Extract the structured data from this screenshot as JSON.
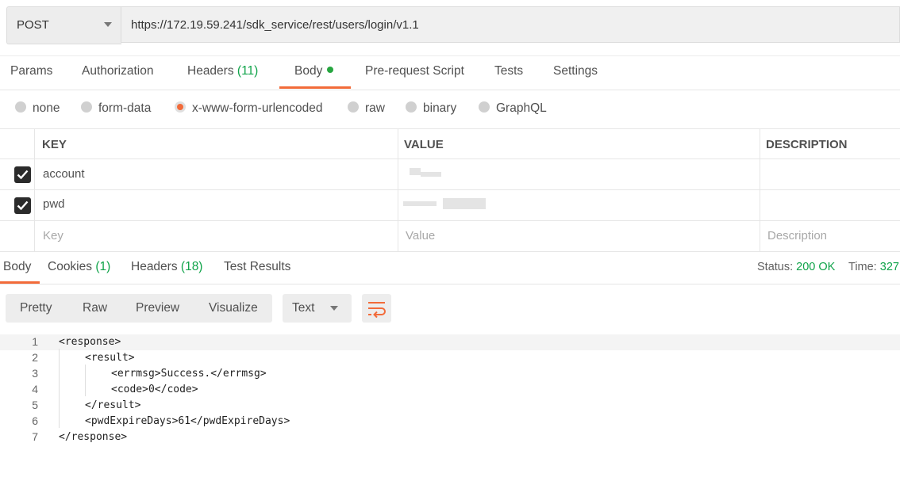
{
  "request": {
    "method": "POST",
    "url": "https://172.19.59.241/sdk_service/rest/users/login/v1.1"
  },
  "request_tabs": [
    {
      "label": "Params",
      "count": ""
    },
    {
      "label": "Authorization",
      "count": ""
    },
    {
      "label": "Headers",
      "count": "(11)"
    },
    {
      "label": "Body",
      "count": ""
    },
    {
      "label": "Pre-request Script",
      "count": ""
    },
    {
      "label": "Tests",
      "count": ""
    },
    {
      "label": "Settings",
      "count": ""
    }
  ],
  "body_types": [
    "none",
    "form-data",
    "x-www-form-urlencoded",
    "raw",
    "binary",
    "GraphQL"
  ],
  "body_type_selected": "x-www-form-urlencoded",
  "table": {
    "headers": [
      "KEY",
      "VALUE",
      "DESCRIPTION"
    ],
    "rows": [
      {
        "key": "account",
        "checked": true
      },
      {
        "key": "pwd",
        "checked": true
      }
    ],
    "placeholders": {
      "key": "Key",
      "value": "Value",
      "description": "Description"
    }
  },
  "response_tabs": [
    {
      "label": "Body",
      "count": ""
    },
    {
      "label": "Cookies",
      "count": "(1)"
    },
    {
      "label": "Headers",
      "count": "(18)"
    },
    {
      "label": "Test Results",
      "count": ""
    }
  ],
  "status": {
    "label": "Status:",
    "value": "200 OK",
    "time_label": "Time:",
    "time_value": "327"
  },
  "view_modes": [
    "Pretty",
    "Raw",
    "Preview",
    "Visualize"
  ],
  "format": "Text",
  "code_lines": [
    {
      "n": "1",
      "text": "<response>"
    },
    {
      "n": "2",
      "text": "<result>"
    },
    {
      "n": "3",
      "text": "<errmsg>Success.</errmsg>"
    },
    {
      "n": "4",
      "text": "<code>0</code>"
    },
    {
      "n": "5",
      "text": "</result>"
    },
    {
      "n": "6",
      "text": "<pwdExpireDays>61</pwdExpireDays>"
    },
    {
      "n": "7",
      "text": "</response>"
    }
  ],
  "colors": {
    "accent": "#f26b3a",
    "success": "#0fa349",
    "dot": "#27a640"
  },
  "icons": [
    "chevron-down-icon",
    "checkbox-checked-icon",
    "wrap-lines-icon"
  ]
}
